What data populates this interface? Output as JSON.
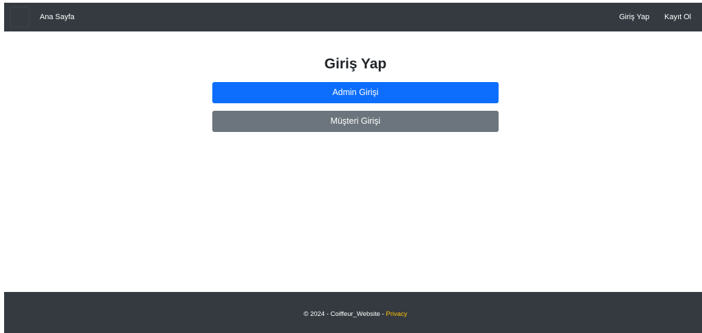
{
  "navbar": {
    "home_label": "Ana Sayfa",
    "login_label": "Giriş Yap",
    "register_label": "Kayıt Ol"
  },
  "main": {
    "title": "Giriş Yap",
    "admin_button_label": "Admin Girişi",
    "customer_button_label": "Müşteri Girişi"
  },
  "footer": {
    "copyright": "© 2024 - Coiffeur_Website - ",
    "privacy_label": "Privacy"
  },
  "colors": {
    "navbar_bg": "#343a40",
    "primary": "#0d6efd",
    "secondary": "#6c757d",
    "footer_link": "#ffc107"
  }
}
